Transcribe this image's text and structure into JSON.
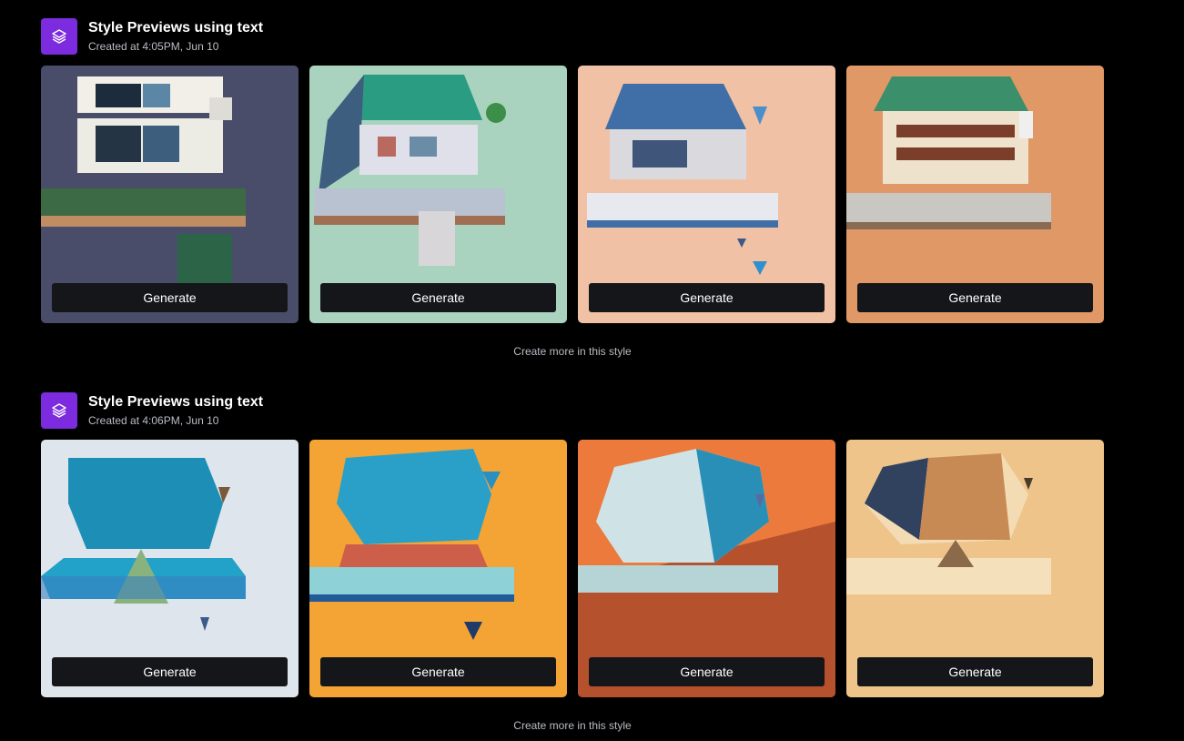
{
  "colors": {
    "background": "#000000",
    "accent": "#7c2bdf",
    "button_bg": "#15161a",
    "muted_text": "#b8bcc4"
  },
  "batches": [
    {
      "icon": "layers-icon",
      "title": "Style Previews using text",
      "subtitle": "Created at 4:05PM, Jun 10",
      "tiles": [
        {
          "image": "white modern house on deck, slate blue background",
          "button_label": "Generate"
        },
        {
          "image": "house with teal roof, mint green background",
          "button_label": "Generate"
        },
        {
          "image": "house with blue roof, peach background",
          "button_label": "Generate"
        },
        {
          "image": "large house with green roof, orange background",
          "button_label": "Generate"
        }
      ],
      "more_label": "Create more in this style"
    },
    {
      "icon": "layers-icon",
      "title": "Style Previews using text",
      "subtitle": "Created at 4:06PM, Jun 10",
      "tiles": [
        {
          "image": "low-poly blue house, white textured background",
          "button_label": "Generate"
        },
        {
          "image": "low-poly blue house, orange background",
          "button_label": "Generate"
        },
        {
          "image": "low-poly pale dome house, orange-red background",
          "button_label": "Generate"
        },
        {
          "image": "low-poly beige house, sand background",
          "button_label": "Generate"
        }
      ],
      "more_label": "Create more in this style"
    }
  ]
}
